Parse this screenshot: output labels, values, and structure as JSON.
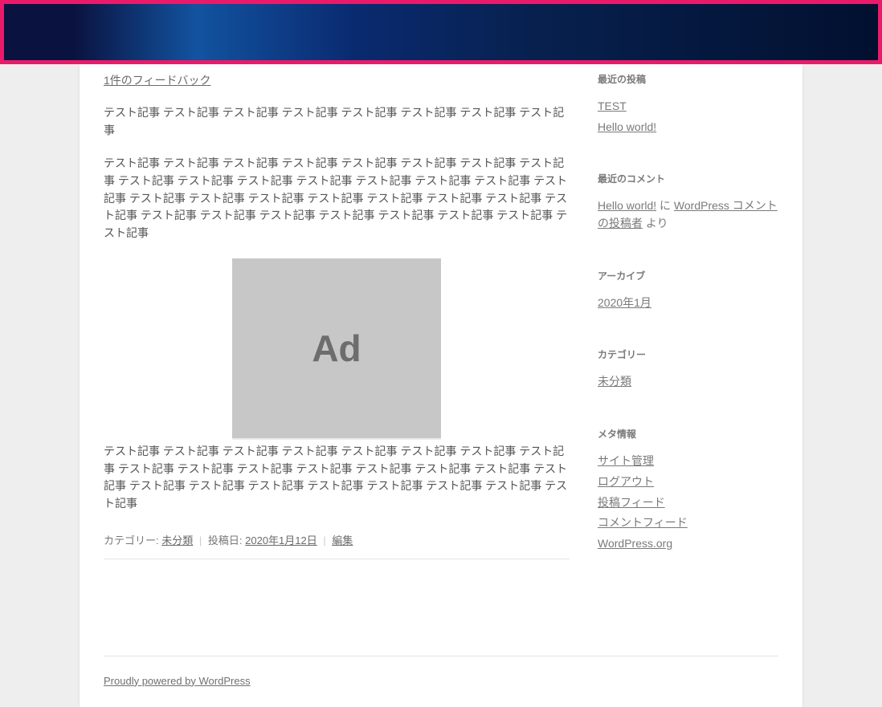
{
  "article": {
    "feedback_link": "1件のフィードバック",
    "para1": "テスト記事 テスト記事 テスト記事 テスト記事 テスト記事 テスト記事 テスト記事 テスト記事",
    "para2": "テスト記事 テスト記事 テスト記事 テスト記事 テスト記事 テスト記事 テスト記事 テスト記事 テスト記事 テスト記事 テスト記事 テスト記事 テスト記事 テスト記事 テスト記事 テスト記事 テスト記事 テスト記事 テスト記事 テスト記事 テスト記事 テスト記事 テスト記事 テスト記事 テスト記事 テスト記事 テスト記事 テスト記事 テスト記事 テスト記事 テスト記事 テスト記事",
    "ad_label": "Ad",
    "para3": "テスト記事 テスト記事 テスト記事 テスト記事 テスト記事 テスト記事 テスト記事 テスト記事 テスト記事 テスト記事 テスト記事 テスト記事 テスト記事 テスト記事 テスト記事 テスト記事 テスト記事 テスト記事 テスト記事 テスト記事 テスト記事 テスト記事 テスト記事 テスト記事",
    "meta": {
      "category_label": "カテゴリー: ",
      "category_value": "未分類",
      "date_label": "投稿日: ",
      "date_value": "2020年1月12日",
      "edit_label": "編集"
    }
  },
  "sidebar": {
    "recent_posts": {
      "title": "最近の投稿",
      "items": [
        "TEST",
        "Hello world!"
      ]
    },
    "recent_comments": {
      "title": "最近のコメント",
      "link1": "Hello world!",
      "ni": " に ",
      "link2": "WordPress コメントの投稿者",
      "yori": " より"
    },
    "archives": {
      "title": "アーカイブ",
      "items": [
        "2020年1月"
      ]
    },
    "categories": {
      "title": "カテゴリー",
      "items": [
        "未分類"
      ]
    },
    "meta": {
      "title": "メタ情報",
      "items": [
        "サイト管理",
        "ログアウト",
        "投稿フィード",
        "コメントフィード",
        "WordPress.org"
      ]
    }
  },
  "footer": {
    "powered": "Proudly powered by WordPress"
  }
}
